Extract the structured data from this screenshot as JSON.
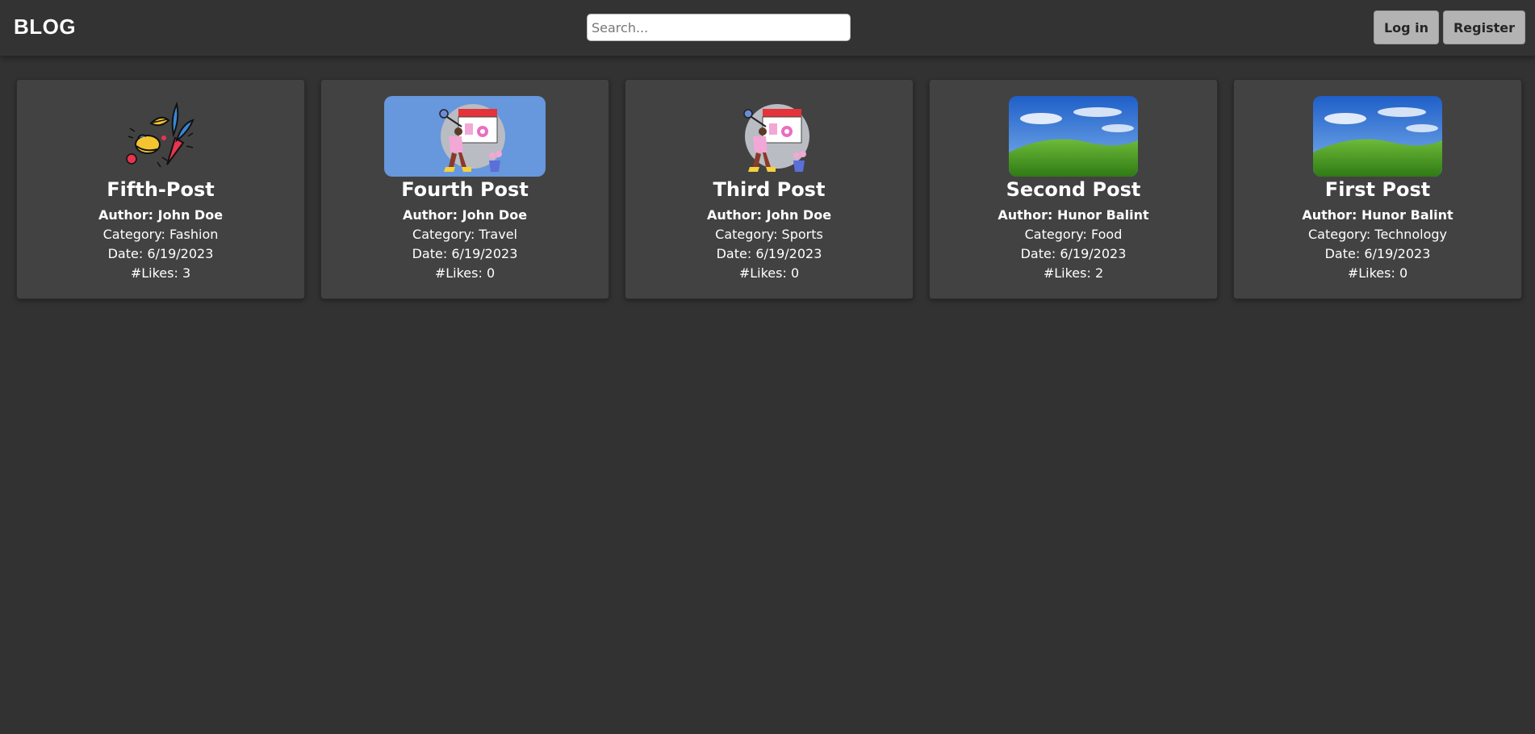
{
  "header": {
    "brand": "BLOG",
    "search_placeholder": "Search...",
    "login_label": "Log in",
    "register_label": "Register"
  },
  "posts": [
    {
      "title": "Fifth-Post",
      "author": "Author: John Doe",
      "category": "Category: Fashion",
      "date": "Date: 6/19/2023",
      "likes": "#Likes: 3",
      "image": "fashion-illustration-icon"
    },
    {
      "title": "Fourth Post",
      "author": "Author: John Doe",
      "category": "Category: Travel",
      "date": "Date: 6/19/2023",
      "likes": "#Likes: 0",
      "image": "painter-illustration-blue-background"
    },
    {
      "title": "Third Post",
      "author": "Author: John Doe",
      "category": "Category: Sports",
      "date": "Date: 6/19/2023",
      "likes": "#Likes: 0",
      "image": "painter-illustration"
    },
    {
      "title": "Second Post",
      "author": "Author: Hunor Balint",
      "category": "Category: Food",
      "date": "Date: 6/19/2023",
      "likes": "#Likes: 2",
      "image": "green-hill-landscape"
    },
    {
      "title": "First Post",
      "author": "Author: Hunor Balint",
      "category": "Category: Technology",
      "date": "Date: 6/19/2023",
      "likes": "#Likes: 0",
      "image": "green-hill-landscape"
    }
  ],
  "colors": {
    "page_bg": "#323232",
    "navbar_bg": "#333333",
    "card_bg": "#424242",
    "button_bg": "#b3b3b3",
    "thumb_blue": "#6797dc"
  }
}
